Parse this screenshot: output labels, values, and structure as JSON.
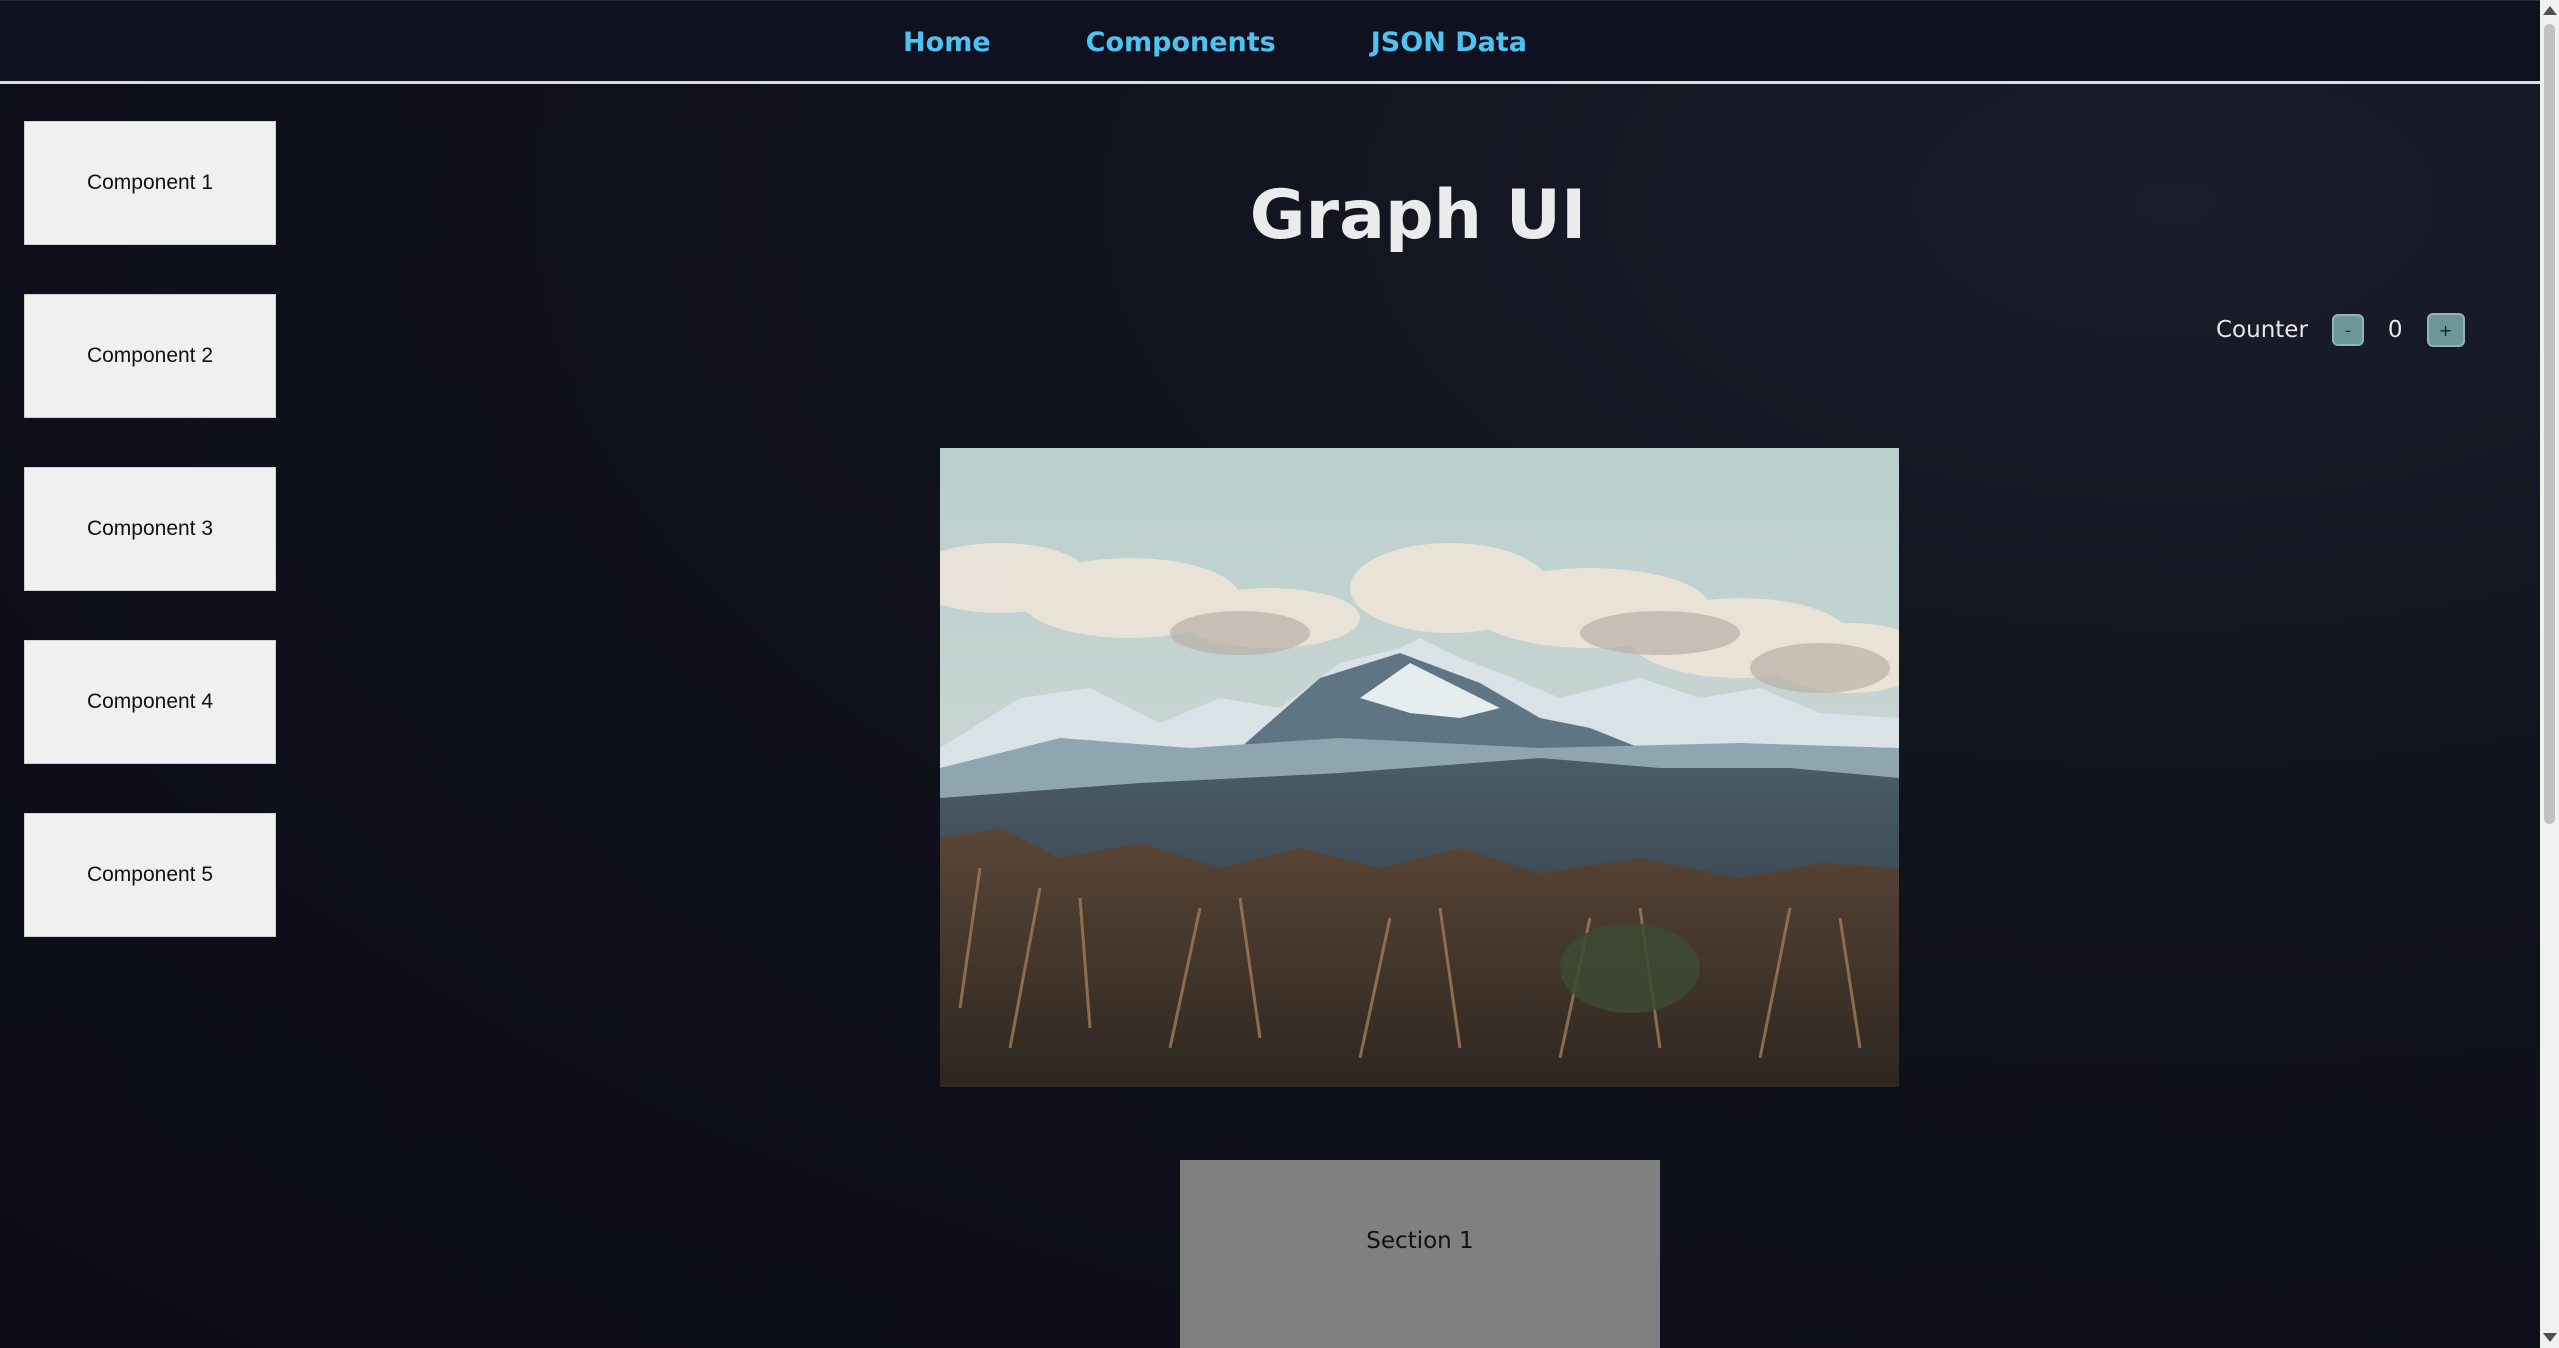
{
  "nav": {
    "links": [
      "Home",
      "Components",
      "JSON Data"
    ]
  },
  "sidebar": {
    "items": [
      "Component 1",
      "Component 2",
      "Component 3",
      "Component 4",
      "Component 5"
    ]
  },
  "main": {
    "title": "Graph UI",
    "counter": {
      "label": "Counter",
      "decrement_label": "-",
      "value": "0",
      "increment_label": "+"
    },
    "sections": [
      "Section 1"
    ]
  },
  "colors": {
    "nav_link": "#4cc3f0",
    "background": "#0c0d18",
    "card": "#f0f0f0",
    "section": "#808080",
    "counter_button": "#6d9797"
  }
}
